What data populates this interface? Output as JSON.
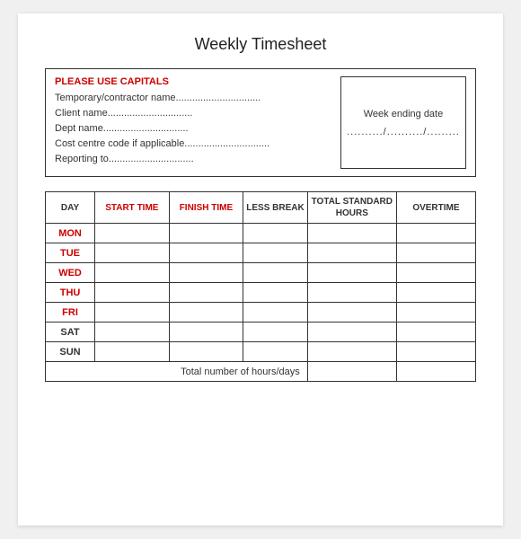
{
  "title": "Weekly Timesheet",
  "infoBox": {
    "header": "PLEASE USE CAPITALS",
    "fields": [
      "Temporary/contractor name...............................",
      "Client name...............................",
      "Dept name...............................",
      "Cost centre code if applicable...............................",
      "Reporting to..............................."
    ],
    "weekEndingLabel": "Week ending date",
    "weekEndingDate": "........../........../........."
  },
  "table": {
    "headers": {
      "day": "DAY",
      "startTime": "START TIME",
      "finishTime": "FINISH TIME",
      "lessBreak": "LESS BREAK",
      "totalStandardHours": "TOTAL STANDARD HOURS",
      "overtime": "OVERTIME"
    },
    "days": [
      {
        "label": "MON",
        "colored": true
      },
      {
        "label": "TUE",
        "colored": true
      },
      {
        "label": "WED",
        "colored": true
      },
      {
        "label": "THU",
        "colored": true
      },
      {
        "label": "FRI",
        "colored": true
      },
      {
        "label": "SAT",
        "colored": false
      },
      {
        "label": "SUN",
        "colored": false
      }
    ],
    "totalRow": {
      "label": "Total number of hours/days"
    }
  }
}
